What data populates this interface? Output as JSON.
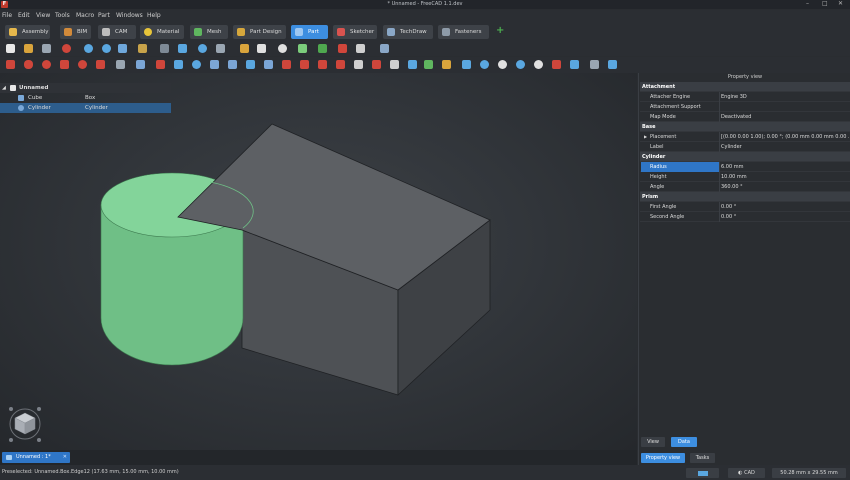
{
  "window": {
    "title": "* Unnamed - FreeCAD 1.1.dev",
    "controls": [
      "–",
      "□",
      "✕"
    ]
  },
  "menu": [
    "File",
    "Edit",
    "View",
    "Tools",
    "Macro",
    "Part",
    "Windows",
    "Help"
  ],
  "workbenches": [
    {
      "label": "Assembly",
      "color": "#e6b84c"
    },
    {
      "label": "BIM",
      "color": "#d28a3a"
    },
    {
      "label": "CAM",
      "color": "#bdbdbd"
    },
    {
      "label": "Material",
      "color": "#e8c53a"
    },
    {
      "label": "Mesh",
      "color": "#5fb65f"
    },
    {
      "label": "Part Design",
      "color": "#d6a73c"
    },
    {
      "label": "Part",
      "color": "#9ec7f0",
      "active": true
    },
    {
      "label": "Sketcher",
      "color": "#d9534f"
    },
    {
      "label": "TechDraw",
      "color": "#8aa7c7"
    },
    {
      "label": "Fasteners",
      "color": "#8d9aa8"
    }
  ],
  "tree": {
    "root": "Unnamed",
    "rows": [
      {
        "name": "Cube",
        "label": "Box",
        "selected": false,
        "icon_color": "#7aa8d8"
      },
      {
        "name": "Cylinder",
        "label": "Cylinder",
        "selected": true,
        "icon_color": "#7aa8d8"
      }
    ]
  },
  "property_view": {
    "title": "Property view",
    "groups": [
      {
        "name": "Attachment",
        "rows": [
          {
            "key": "Attacher Engine",
            "value": "Engine 3D"
          },
          {
            "key": "Attachment Support",
            "value": ""
          },
          {
            "key": "Map Mode",
            "value": "Deactivated"
          }
        ]
      },
      {
        "name": "Base",
        "rows": [
          {
            "key": "Placement",
            "value": "[(0.00 0.00 1.00); 0.00 °; (0.00 mm  0.00 mm  0.00 ...",
            "expandable": true
          },
          {
            "key": "Label",
            "value": "Cylinder"
          }
        ]
      },
      {
        "name": "Cylinder",
        "rows": [
          {
            "key": "Radius",
            "value": "6.00 mm",
            "selected": true
          },
          {
            "key": "Height",
            "value": "10.00 mm"
          },
          {
            "key": "Angle",
            "value": "360.00 °"
          }
        ]
      },
      {
        "name": "Prism",
        "rows": [
          {
            "key": "First Angle",
            "value": "0.00 °"
          },
          {
            "key": "Second Angle",
            "value": "0.00 °"
          }
        ]
      }
    ],
    "view_tab": "View",
    "data_tab": "Data",
    "bottom_tabs": [
      "Property view",
      "Tasks"
    ]
  },
  "document_tab": {
    "label": "Unnamed : 1*",
    "close": "✕"
  },
  "status": {
    "message": "Preselected: Unnamed.Box.Edge12 (17.63 mm, 15.00 mm, 10.00 mm)",
    "nav_style": "CAD",
    "dimensions": "50.28 mm x 29.55 mm"
  },
  "colors": {
    "accent": "#3d8ee0",
    "cylinder_fill": "#6fbf86",
    "box_fill": "#4a4d51"
  }
}
